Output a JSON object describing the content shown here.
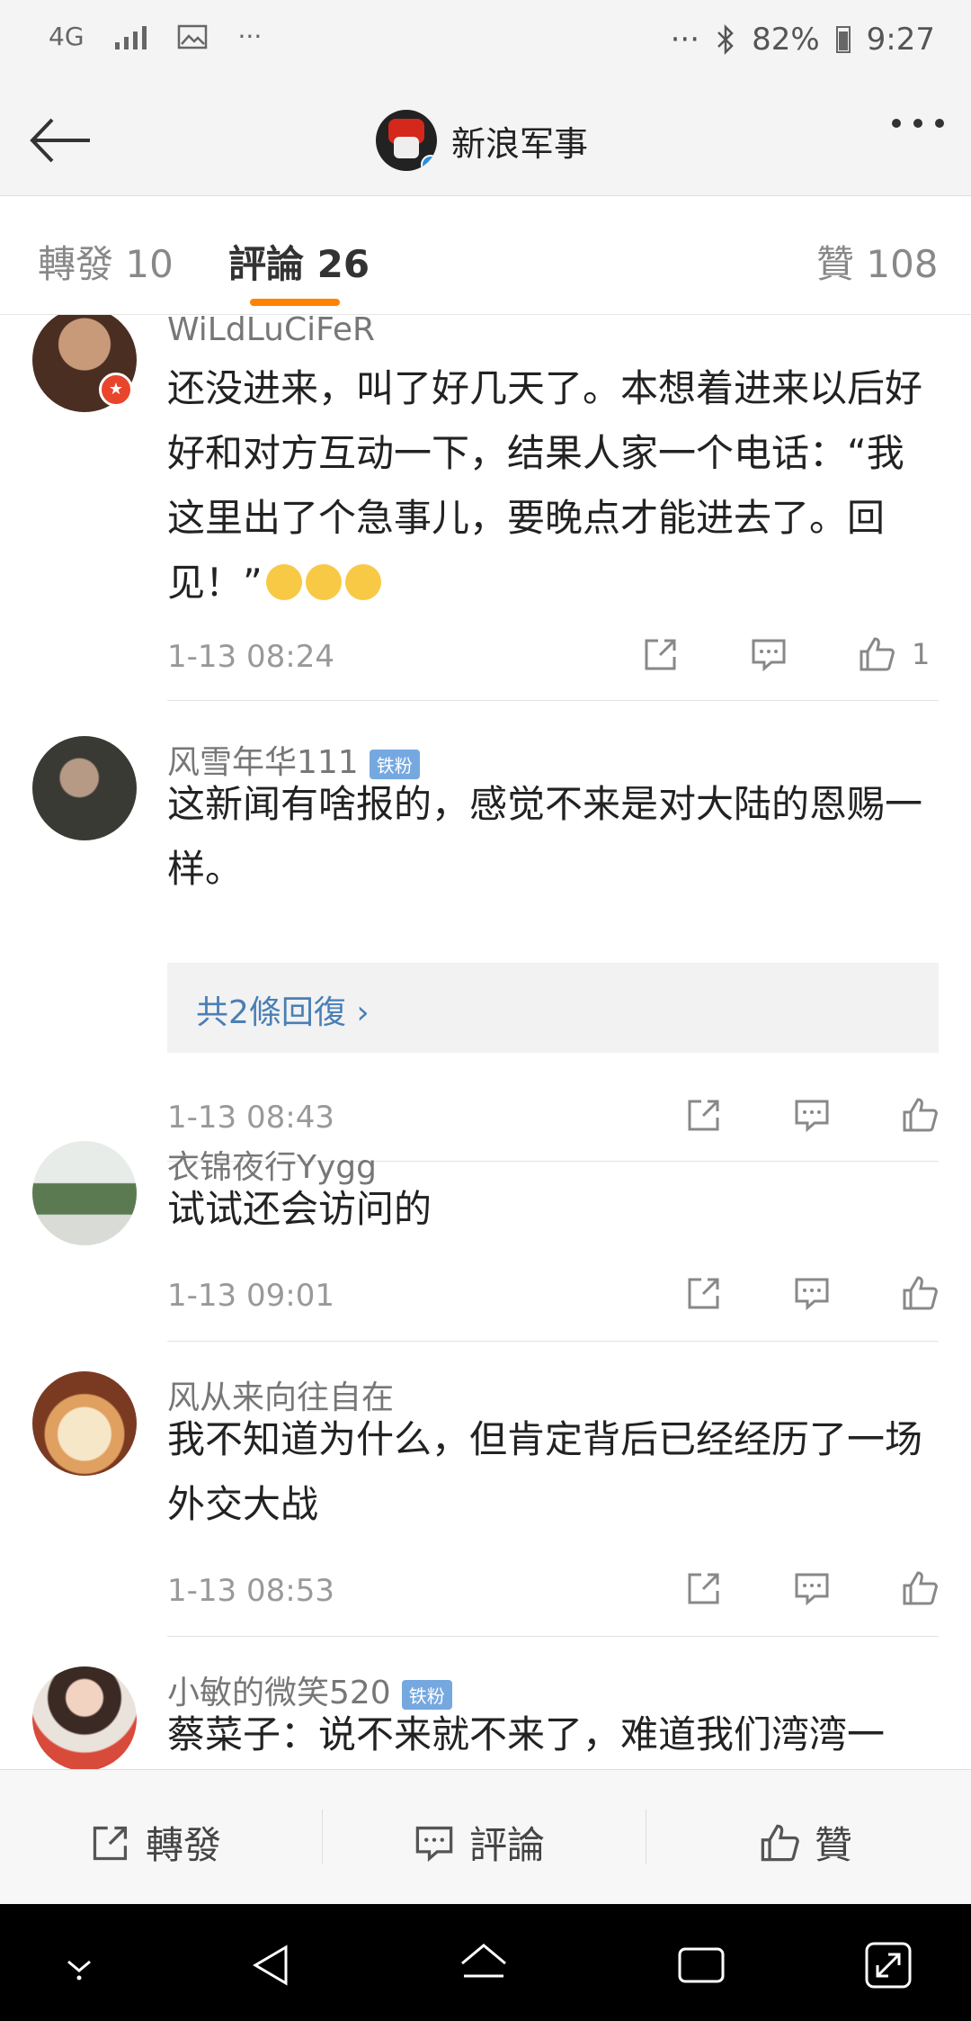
{
  "status_bar": {
    "network": "4G",
    "left_more": "···",
    "right_more": "···",
    "battery": "82%",
    "time": "9:27"
  },
  "header": {
    "title": "新浪军事"
  },
  "tabs": {
    "repost": "轉發 10",
    "comments": "評論 26",
    "likes": "贊 108"
  },
  "comments": [
    {
      "name": "WiLdLuCiFeR",
      "text": "还没进来，叫了好几天了。本想着进来以后好好和对方互动一下，结果人家一个电话：“我这里出了个急事儿，要晚点才能进去了。回见！”",
      "time": "1-13 08:24",
      "likes": "1"
    },
    {
      "name": "风雪年华111",
      "tag": "铁粉",
      "text": "这新闻有啥报的，感觉不来是对大陆的恩赐一样。",
      "reply_summary": "共2條回復 ›",
      "time": "1-13 08:43"
    },
    {
      "name": "衣锦夜行Yygg",
      "text": "试试还会访问的",
      "time": "1-13 09:01"
    },
    {
      "name": "风从来向往自在",
      "text": "我不知道为什么，但肯定背后已经经历了一场外交大战",
      "time": "1-13 08:53"
    },
    {
      "name": "小敏的微笑520",
      "tag": "铁粉",
      "text": "蔡菜子：说不来就不来了，难道我们湾湾一"
    }
  ],
  "bottom_bar": {
    "repost": "轉發",
    "comment": "評論",
    "like": "贊"
  },
  "colors": {
    "accent": "#ff8200",
    "link": "#4a7fb5",
    "tag": "#76a8e0"
  }
}
